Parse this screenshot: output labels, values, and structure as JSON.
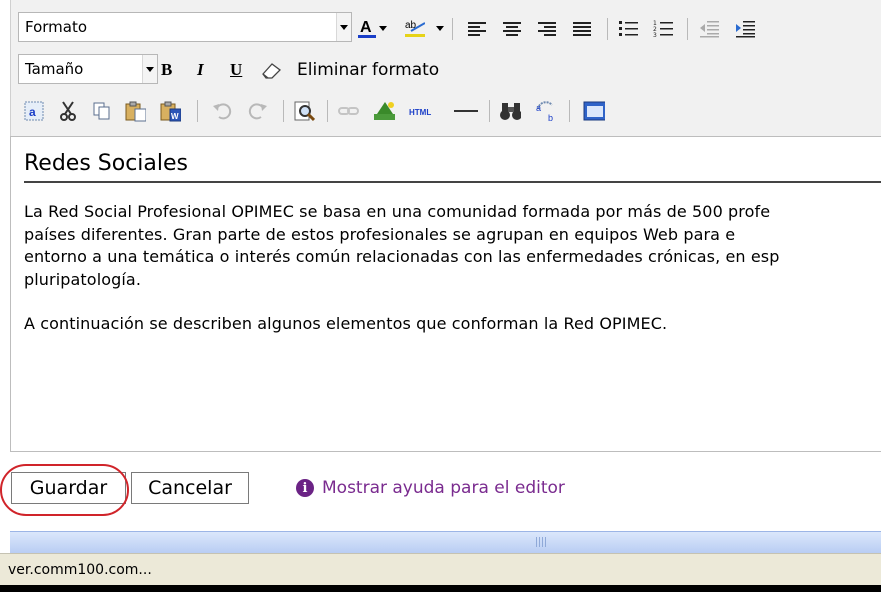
{
  "toolbar": {
    "format_combo": {
      "value": "Formato"
    },
    "size_combo": {
      "value": "Tamaño"
    },
    "bold_label": "B",
    "italic_label": "I",
    "underline_label": "U",
    "remove_format_label": "Eliminar formato",
    "html_label": "HTML"
  },
  "editor": {
    "heading": "Redes Sociales",
    "paragraph1_lines": [
      "La Red Social Profesional OPIMEC se basa en una comunidad formada por más de 500 profe",
      "países diferentes. Gran parte de estos profesionales se agrupan en equipos Web para e",
      "entorno a una temática o interés común relacionadas con las enfermedades crónicas, en esp",
      "pluripatología."
    ],
    "paragraph2": "A continuación se describen algunos elementos que conforman la Red OPIMEC."
  },
  "actions": {
    "save_label": "Guardar",
    "cancel_label": "Cancelar",
    "help_label": "Mostrar ayuda para el editor",
    "help_icon_text": "i"
  },
  "status": {
    "url": "ver.comm100.com..."
  },
  "colors": {
    "highlight_ring": "#d0242a",
    "help_link": "#7a2b8f"
  }
}
